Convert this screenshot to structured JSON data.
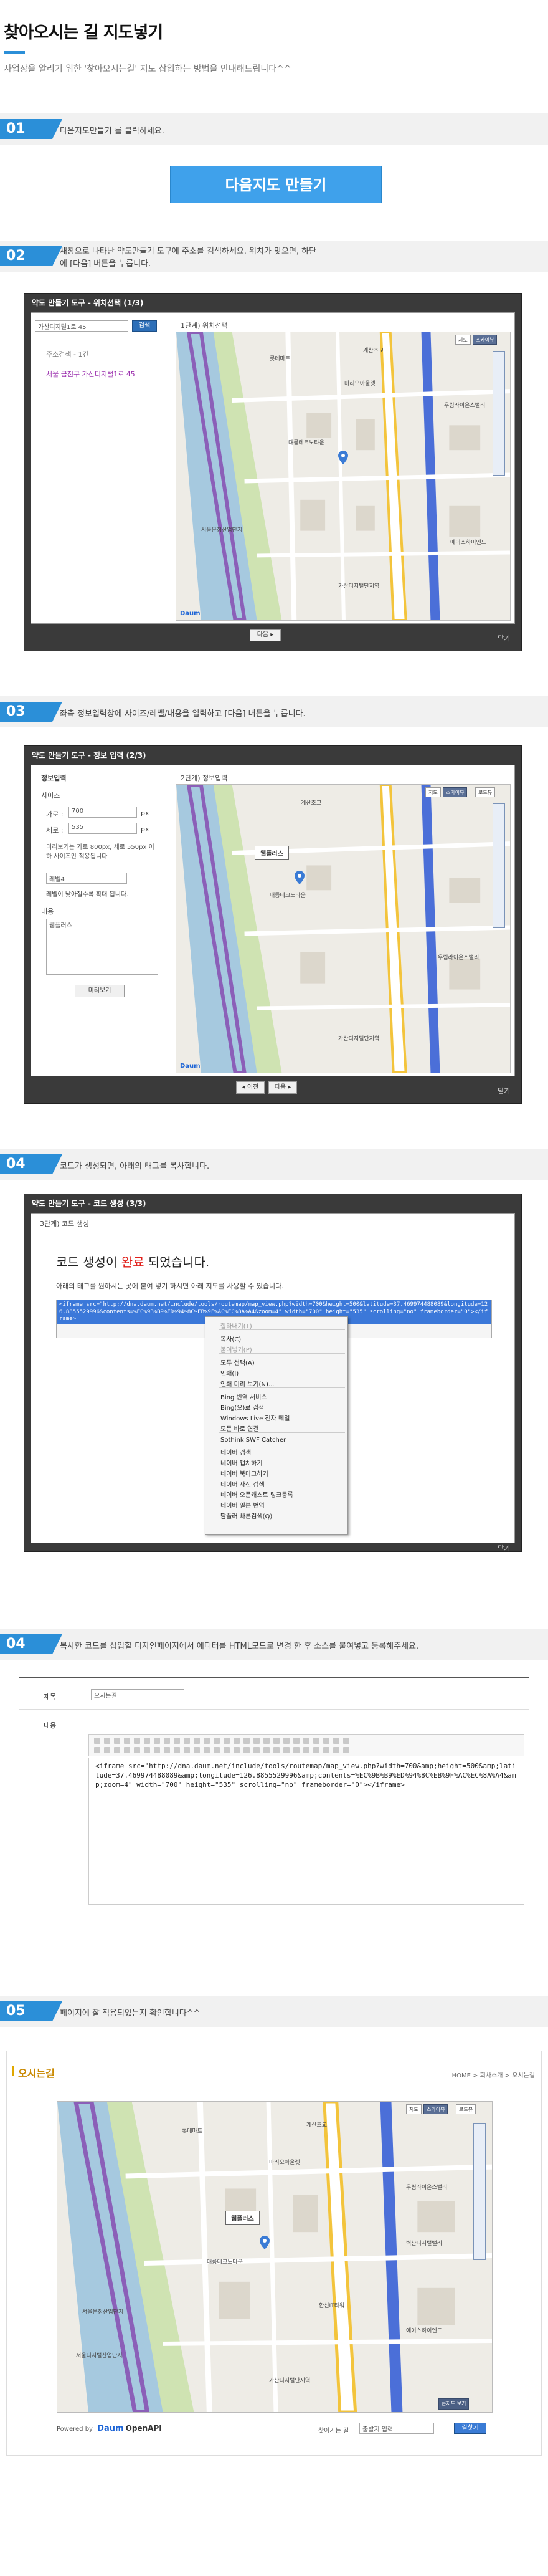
{
  "page": {
    "title": "찾아오시는 길 지도넣기",
    "description": "사업장을 알리기 위한 '찾아오시는길' 지도 삽입하는 방법을 안내해드립니다^^"
  },
  "steps": [
    {
      "num": "01",
      "text": "다음지도만들기 를 클릭하세요."
    },
    {
      "num": "02",
      "text": "새창으로 나타난 약도만들기 도구에 주소를 검색하세요. 위치가 맞으면, 하단에 [다음] 버튼을 누릅니다."
    },
    {
      "num": "03",
      "text": "좌측 정보입력창에 사이즈/레벨/내용을 입력하고 [다음] 버튼을 누릅니다."
    },
    {
      "num": "04",
      "text": "코드가 생성되면, 아래의 태그를 복사합니다."
    },
    {
      "num": "04",
      "text": "복사한 코드를 삽입할 디자인페이지에서 에디터를 HTML모드로 변경 한 후 소스를 붙여넣고 등록해주세요."
    },
    {
      "num": "05",
      "text": "페이지에 잘 적용되었는지 확인합니다^^"
    }
  ],
  "cta": {
    "label": "다음지도 만들기"
  },
  "dialog1": {
    "title": "약도 만들기 도구 - 위치선택 (1/3)",
    "search_placeholder": "가산디지털1로 45",
    "search_btn": "검색",
    "result_header": "주소검색 - 1건",
    "result_item": "서울 금천구 가산디지털1로 45",
    "map_header": "1단계) 위치선택",
    "next_btn": "다음 ▸",
    "close": "닫기"
  },
  "dialog2": {
    "title": "약도 만들기 도구 - 정보 입력 (2/3)",
    "info_header": "정보입력",
    "size_label": "사이즈",
    "width_label": "가로 :",
    "width_value": "700",
    "height_label": "세로 :",
    "height_value": "535",
    "px": "px",
    "size_note": "미리보기는 가로 800px, 세로 550px 이하 사이즈만 적용됩니다",
    "level_label": "레벨4",
    "level_note": "레벨이 낮아질수록 확대 됩니다.",
    "content_label": "내용",
    "content_value": "웹플러스",
    "preview_btn": "미리보기",
    "map_header": "2단계) 정보입력",
    "popup": "웹플러스",
    "prev_btn": "◂ 이전",
    "next_btn": "다음 ▸",
    "close": "닫기"
  },
  "dialog3": {
    "title": "약도 만들기 도구 - 코드 생성 (3/3)",
    "header": "3단계) 코드 생성",
    "done_prefix": "코드 생성이 ",
    "done_highlight": "완료",
    "done_suffix": " 되었습니다.",
    "instruction": "아래의 태그를 원하시는 곳에 붙여 넣기 하시면 아래 지도를 사용할 수 있습니다.",
    "code": "<iframe src=\"http://dna.daum.net/include/tools/routemap/map_view.php?width=700&height=500&latitude=37.469974488089&longitude=126.8855529996&contents=%EC%9B%B9%ED%94%8C%EB%9F%AC%EC%8A%A4&zoom=4\" width=\"700\" height=\"535\" scrolling=\"no\" frameborder=\"0\"></iframe>",
    "close": "닫기",
    "menu": [
      {
        "label": "잘라내기(T)",
        "disabled": true
      },
      {
        "label": "복사(C)",
        "disabled": false
      },
      {
        "label": "붙여넣기(P)",
        "disabled": true
      },
      {
        "label": "모두 선택(A)",
        "disabled": false
      },
      {
        "label": "인쇄(I)",
        "disabled": false
      },
      {
        "label": "인쇄 미리 보기(N)...",
        "disabled": false
      },
      {
        "label": "Bing 번역 서비스",
        "disabled": false
      },
      {
        "label": "Bing(으)로 검색",
        "disabled": false
      },
      {
        "label": "Windows Live 전자 메일",
        "disabled": false
      },
      {
        "label": "모든 바로 연결",
        "disabled": false
      },
      {
        "label": "Sothink SWF Catcher",
        "disabled": false
      },
      {
        "label": "네이버 검색",
        "disabled": false
      },
      {
        "label": "네이버 캡쳐하기",
        "disabled": false
      },
      {
        "label": "네이버 북마크하기",
        "disabled": false
      },
      {
        "label": "네이버 사전 검색",
        "disabled": false
      },
      {
        "label": "네이버 오픈캐스트 링크등록",
        "disabled": false
      },
      {
        "label": "네이버 일본 번역",
        "disabled": false
      },
      {
        "label": "탐플러 빠른검색(Q)",
        "disabled": false
      }
    ]
  },
  "editor": {
    "subject_label": "제목",
    "subject_value": "오시는길",
    "content_label": "내용",
    "code": "<iframe src=\"http://dna.daum.net/include/tools/routemap/map_view.php?width=700&amp;height=500&amp;latitude=37.469974488089&amp;longitude=126.8855529996&amp;contents=%EC%9B%B9%ED%94%8C%EB%9F%AC%EC%8A%A4&amp;zoom=4\" width=\"700\" height=\"535\" scrolling=\"no\" frameborder=\"0\"></iframe>"
  },
  "result": {
    "title": "오시는길",
    "breadcrumb": "HOME > 회사소개 > 오시는길",
    "popup": "웹플러스",
    "powered_by": "Powered by",
    "powered_brand": "Daum",
    "powered_suffix": "OpenAPI",
    "search_label": "찾아가는 길",
    "search_placeholder": "출발지 입력",
    "search_btn": "길찾기",
    "view_btn": "큰지도 보기"
  },
  "map_labels": [
    "계산초교",
    "롯데마트",
    "마리오아울렛",
    "대륭테크노타운",
    "서울문정산업단지",
    "가산디지털단지역",
    "우림라이온스밸리",
    "에이스하이엔드",
    "한신IT타워",
    "벽산디지털밸리",
    "서울디지털산업단지"
  ],
  "map_buttons": [
    "지도",
    "스카이뷰",
    "로드뷰"
  ],
  "colors": {
    "accent": "#2b8fd8",
    "dialog_bg": "#3a3a3a"
  }
}
